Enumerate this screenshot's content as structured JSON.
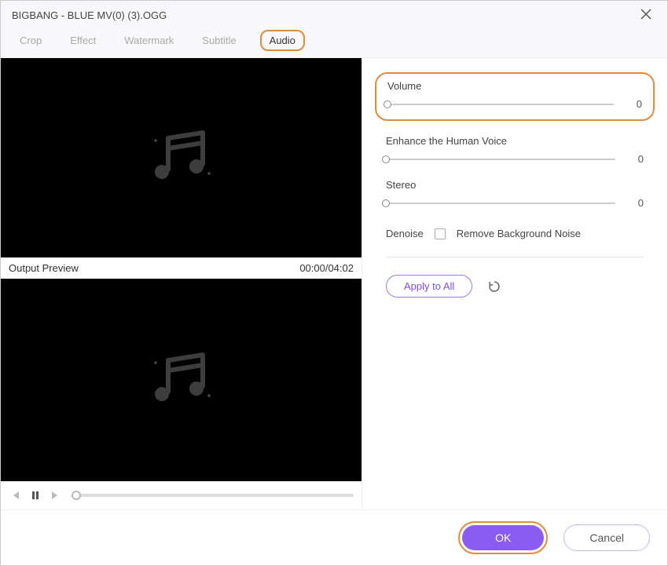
{
  "title": "BIGBANG - BLUE MV(0) (3).OGG",
  "tabs": [
    "Crop",
    "Effect",
    "Watermark",
    "Subtitle",
    "Audio"
  ],
  "active_tab_index": 4,
  "preview_label": "Output Preview",
  "time_display": "00:00/04:02",
  "params": {
    "volume": {
      "label": "Volume",
      "value": 0
    },
    "enhance": {
      "label": "Enhance the Human Voice",
      "value": 0
    },
    "stereo": {
      "label": "Stereo",
      "value": 0
    }
  },
  "denoise": {
    "label": "Denoise",
    "checkbox_label": "Remove Background Noise",
    "checked": false
  },
  "apply_label": "Apply to All",
  "ok_label": "OK",
  "cancel_label": "Cancel"
}
